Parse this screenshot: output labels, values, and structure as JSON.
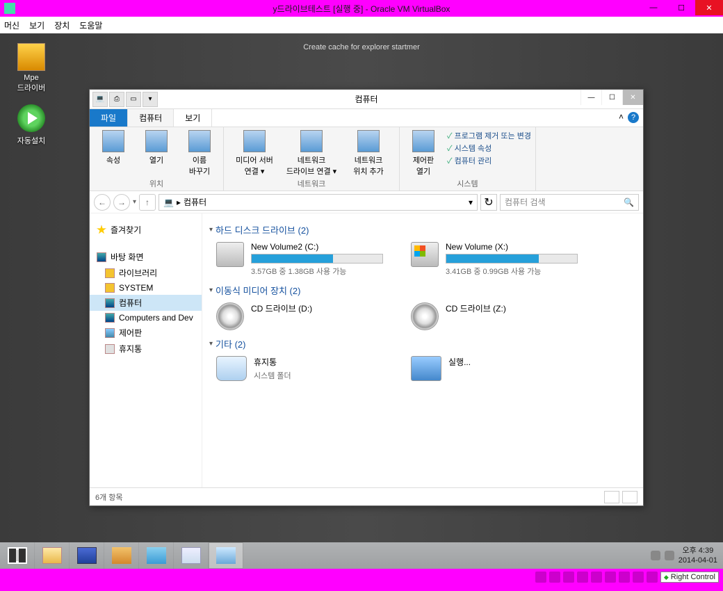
{
  "vbox": {
    "title": "y드라이브테스트 [실행 중] - Oracle VM VirtualBox",
    "menus": [
      "머신",
      "보기",
      "장치",
      "도움말"
    ],
    "min": "—",
    "max": "☐",
    "close": "✕",
    "hostkey": "Right Control"
  },
  "desktop": {
    "cache_msg": "Create cache for explorer startmer",
    "icons": [
      {
        "label": "Mpe\n드라이버"
      },
      {
        "label": "자동설치"
      }
    ]
  },
  "explorer": {
    "title": "컴퓨터",
    "tabs": {
      "file": "파일",
      "computer": "컴퓨터",
      "view": "보기"
    },
    "winctrl": {
      "min": "—",
      "max": "☐",
      "close": "✕"
    },
    "ribbon": {
      "location": {
        "label": "위치",
        "items": [
          "속성",
          "열기",
          "이름\n바꾸기"
        ]
      },
      "network": {
        "label": "네트워크",
        "items": [
          "미디어 서버\n연결 ▾",
          "네트워크\n드라이브 연결 ▾",
          "네트워크\n위치 추가"
        ]
      },
      "system": {
        "label": "시스템",
        "cp": "제어판\n열기",
        "links": [
          "프로그램 제거 또는 변경",
          "시스템 속성",
          "컴퓨터 관리"
        ]
      }
    },
    "addr": {
      "back": "←",
      "fwd": "→",
      "drop": "▾",
      "up": "↑",
      "path_prefix": "▸",
      "path": "컴퓨터",
      "path_drop": "▾",
      "refresh": "↻"
    },
    "search": {
      "placeholder": "컴퓨터 검색",
      "icon": "🔍"
    },
    "nav": {
      "favorites": "즐겨찾기",
      "desktop": "바탕 화면",
      "items": [
        "라이브러리",
        "SYSTEM",
        "컴퓨터",
        "Computers and Dev",
        "제어판",
        "휴지통"
      ]
    },
    "groups": {
      "hdd": {
        "header": "하드 디스크 드라이브 (2)",
        "drives": [
          {
            "name": "New Volume2 (C:)",
            "sub": "3.57GB 중 1.38GB 사용 가능",
            "pct": 62
          },
          {
            "name": "New Volume (X:)",
            "sub": "3.41GB 중 0.99GB 사용 가능",
            "pct": 71
          }
        ]
      },
      "removable": {
        "header": "이동식 미디어 장치 (2)",
        "drives": [
          {
            "name": "CD 드라이브 (D:)"
          },
          {
            "name": "CD 드라이브 (Z:)"
          }
        ]
      },
      "other": {
        "header": "기타 (2)",
        "items": [
          {
            "name": "휴지통",
            "sub": "시스템 폴더"
          },
          {
            "name": "실행..."
          }
        ]
      }
    },
    "status": {
      "count": "6개 항목"
    }
  },
  "taskbar": {
    "time": "오후 4:39",
    "date": "2014-04-01"
  }
}
